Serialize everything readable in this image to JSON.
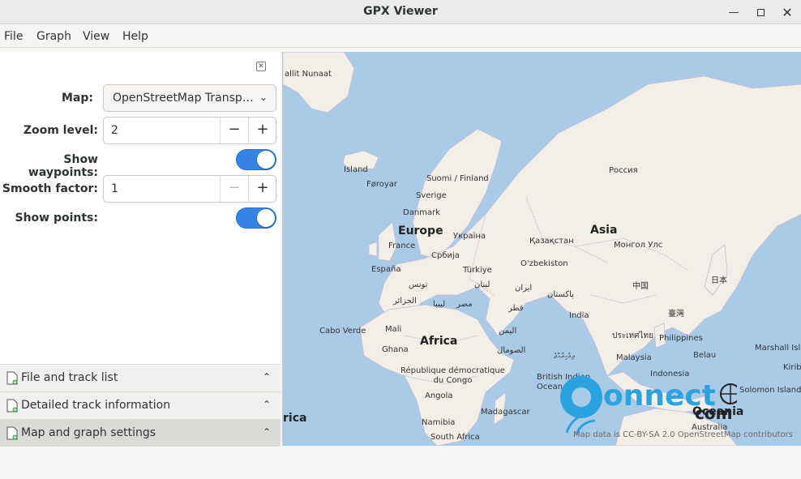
{
  "window": {
    "title": "GPX Viewer"
  },
  "menubar": {
    "items": [
      "File",
      "Graph",
      "View",
      "Help"
    ]
  },
  "settings": {
    "map_label": "Map:",
    "map_value": "OpenStreetMap Transp…",
    "zoom_label": "Zoom level:",
    "zoom_value": "2",
    "waypoints_label": "Show waypoints:",
    "waypoints_on": true,
    "smooth_label": "Smooth factor:",
    "smooth_value": "1",
    "points_label": "Show points:",
    "points_on": true
  },
  "sections": {
    "file_track_list": "File and track list",
    "detailed_track_info": "Detailed track information",
    "map_graph_settings": "Map and graph settings"
  },
  "map": {
    "labels": {
      "nunaat": "allit Nunaat",
      "island": "Island",
      "foroyar": "Føroyar",
      "suomi": "Suomi / Finland",
      "sverige": "Sverige",
      "danmark": "Danmark",
      "europe": "Europe",
      "ukraina": "Україна",
      "france": "France",
      "srbija": "Србија",
      "espana": "España",
      "turkiye": "Türkiye",
      "tunis": "تونس",
      "lubnan": "لبنان",
      "iran": "ایران",
      "jazair": "الجزائر",
      "libya": "ليبيا",
      "misr": "مصر",
      "qatar": "قطر",
      "pakistan": "پاکستان",
      "rossiya": "Россия",
      "asia": "Asia",
      "kazakhstan": "Қазақстан",
      "mongol": "Монгол Улс",
      "uzbekiston": "O'zbekiston",
      "zhongguo": "中国",
      "nihon": "日本",
      "taiwan": "臺灣",
      "india": "India",
      "thailand": "ประเทศไทย",
      "philippines": "Philippines",
      "malaysia": "Malaysia",
      "belau": "Belau",
      "indonesia": "Indonesia",
      "marshall": "Marshall Isla",
      "kiribati": "Kirib",
      "solomon": "Solomon Island",
      "oceania": "Oceania",
      "australia": "Australia",
      "cabo_verde": "Cabo Verde",
      "mali": "Mali",
      "ghana": "Ghana",
      "africa": "Africa",
      "yemen": "اليمن",
      "somal": "الصومال",
      "congo": "République démocratique\ndu Congo",
      "biot": "British Indian\nOcean Territory",
      "angola": "Angola",
      "madagascar": "Madagascar",
      "namibia": "Namibia",
      "south_africa": "South Africa",
      "rica": "rica",
      "dhivehi": "ދިވެހިރާއްޖެ"
    },
    "attribution": "Map data is CC-BY-SA 2.0 OpenStreetMap contributors",
    "watermark_text": "onnect",
    "watermark_suffix": "com"
  },
  "colors": {
    "accent": "#3584e4",
    "land": "#f2efe9",
    "water": "#aacbe8",
    "border": "#b9a7c9"
  }
}
